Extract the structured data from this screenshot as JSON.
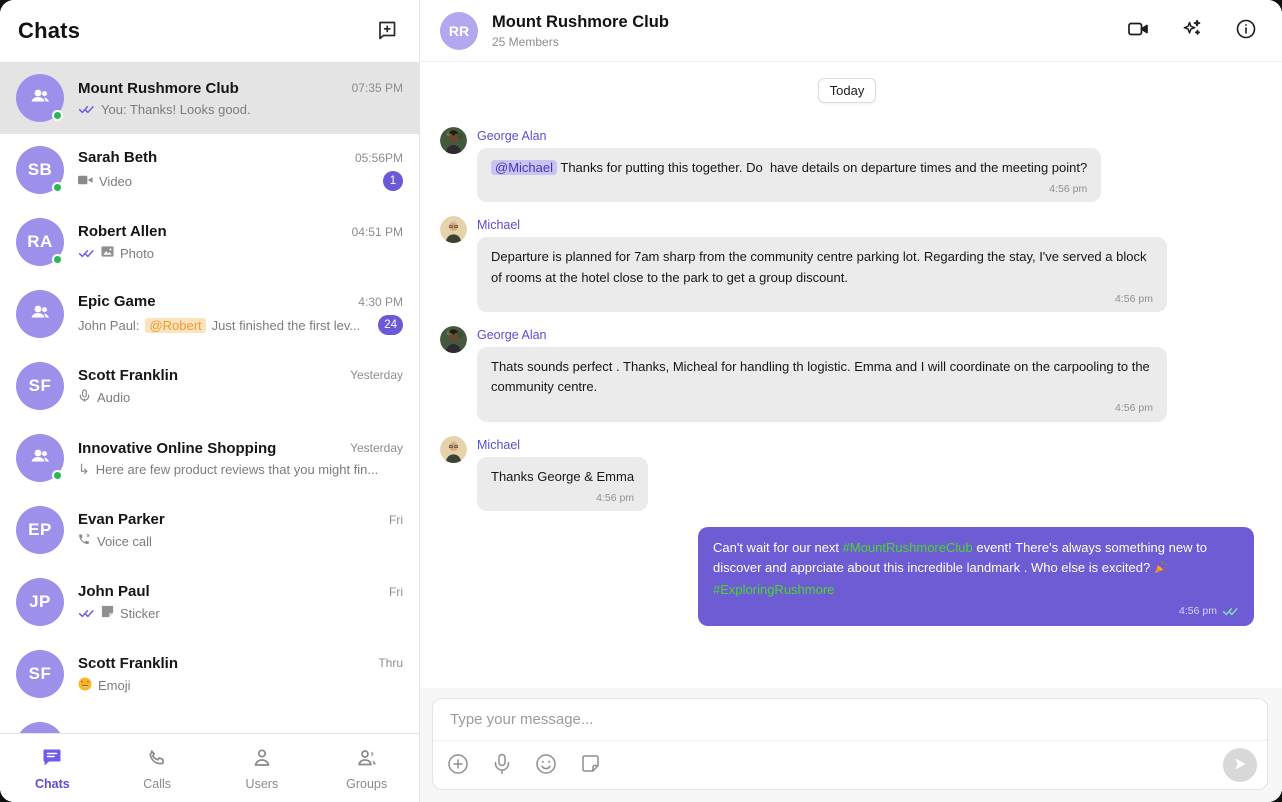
{
  "colors": {
    "accent_purple": "#6C5CE7",
    "outgoing_bubble": "#6D5CD3",
    "incoming_bubble": "#EBEBEB",
    "avatar_purple": "#9D90EA",
    "badge_purple": "#6A5AD8",
    "online_green": "#27B956",
    "hashtag_green": "#49D62E",
    "mention_purple_bg": "#C9C3F2",
    "mention_orange_text": "#EE9B2E"
  },
  "sidebar": {
    "title": "Chats",
    "chats": [
      {
        "name": "Mount Rushmore Club",
        "avatar": "group",
        "online": true,
        "time": "07:35 PM",
        "selected": true,
        "preview": {
          "read_receipt": "double-check",
          "text": "You: Thanks! Looks good."
        }
      },
      {
        "name": "Sarah Beth",
        "initials": "SB",
        "online": true,
        "time": "05:56PM",
        "badge": "1",
        "preview": {
          "icon": "video-icon",
          "text": "Video"
        }
      },
      {
        "name": "Robert Allen",
        "initials": "RA",
        "online": true,
        "time": "04:51 PM",
        "preview": {
          "read_receipt": "double-check",
          "icon": "photo-icon",
          "text": "Photo"
        }
      },
      {
        "name": "Epic Game",
        "avatar": "group",
        "time": "4:30 PM",
        "badge": "24",
        "preview": {
          "prefix": "John Paul:",
          "mention": "@Robert",
          "text": "Just finished the first lev..."
        }
      },
      {
        "name": "Scott Franklin",
        "initials": "SF",
        "time": "Yesterday",
        "preview": {
          "icon": "mic-icon",
          "text": "Audio"
        }
      },
      {
        "name": "Innovative Online Shopping",
        "avatar": "group",
        "online": true,
        "time": "Yesterday",
        "preview": {
          "icon": "reply-arrow",
          "reply_arrow": "↳",
          "text": "Here are few product reviews that you might fin..."
        }
      },
      {
        "name": "Evan Parker",
        "initials": "EP",
        "time": "Fri",
        "preview": {
          "icon": "voice-call-icon",
          "text": "Voice call"
        }
      },
      {
        "name": "John Paul",
        "initials": "JP",
        "time": "Fri",
        "preview": {
          "read_receipt": "double-check",
          "icon": "sticker-icon",
          "text": "Sticker"
        }
      },
      {
        "name": "Scott Franklin",
        "initials": "SF",
        "time": "Thru",
        "preview": {
          "icon": "heart-eyes-emoji",
          "emoji": "😍",
          "text": "Emoji"
        }
      }
    ],
    "nav": [
      {
        "label": "Chats",
        "active": true
      },
      {
        "label": "Calls"
      },
      {
        "label": "Users"
      },
      {
        "label": "Groups"
      }
    ]
  },
  "chat": {
    "title": "Mount Rushmore Club",
    "initials": "RR",
    "subtitle": "25 Members",
    "date_chip": "Today",
    "messages": [
      {
        "sender": "George Alan",
        "time": "4:56 pm",
        "mention": "@Michael",
        "text": " Thanks for putting this together. Do  have details on departure times and the meeting point?"
      },
      {
        "sender": "Michael",
        "time": "4:56 pm",
        "text": "Departure is planned for 7am sharp from the community centre parking lot. Regarding the stay, I've served a block of rooms at the hotel close to the park to get a group discount."
      },
      {
        "sender": "George Alan",
        "time": "4:56 pm",
        "text": "Thats sounds perfect . Thanks, Micheal for handling th logistic. Emma and I will coordinate on the carpooling to the community centre."
      },
      {
        "sender": "Michael",
        "time": "4:56 pm",
        "text": "Thanks George & Emma"
      },
      {
        "outgoing": true,
        "time": "4:56 pm",
        "segments": {
          "t1": "Can't wait for our next ",
          "hashtag1": "#MountRushmoreClub",
          "t2": " event! There's always something new to discover and apprciate about this incredible landmark . Who else is excited? ",
          "emoji": "🎉",
          "hashtag2": "#ExploringRushmore"
        }
      }
    ],
    "composer": {
      "placeholder": "Type your message..."
    }
  }
}
